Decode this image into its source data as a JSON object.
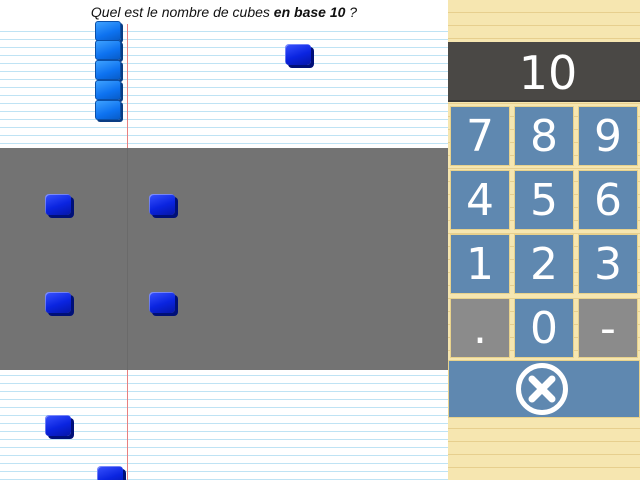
{
  "question": {
    "prefix": "Quel est le nombre de cubes ",
    "emphasis": "en base 10",
    "suffix": " ?"
  },
  "keypad": {
    "display_value": "10",
    "keys": [
      "7",
      "8",
      "9",
      "4",
      "5",
      "6",
      "1",
      "2",
      "3",
      ".",
      "0",
      "-"
    ],
    "clear_icon": "close-circle-icon"
  },
  "colors": {
    "cube_blue": "#0a24e0",
    "rod_blue": "#0d72f0",
    "keypad_blue": "#5f88b0",
    "display_dark": "#4a4845",
    "band_gray": "#737373"
  }
}
